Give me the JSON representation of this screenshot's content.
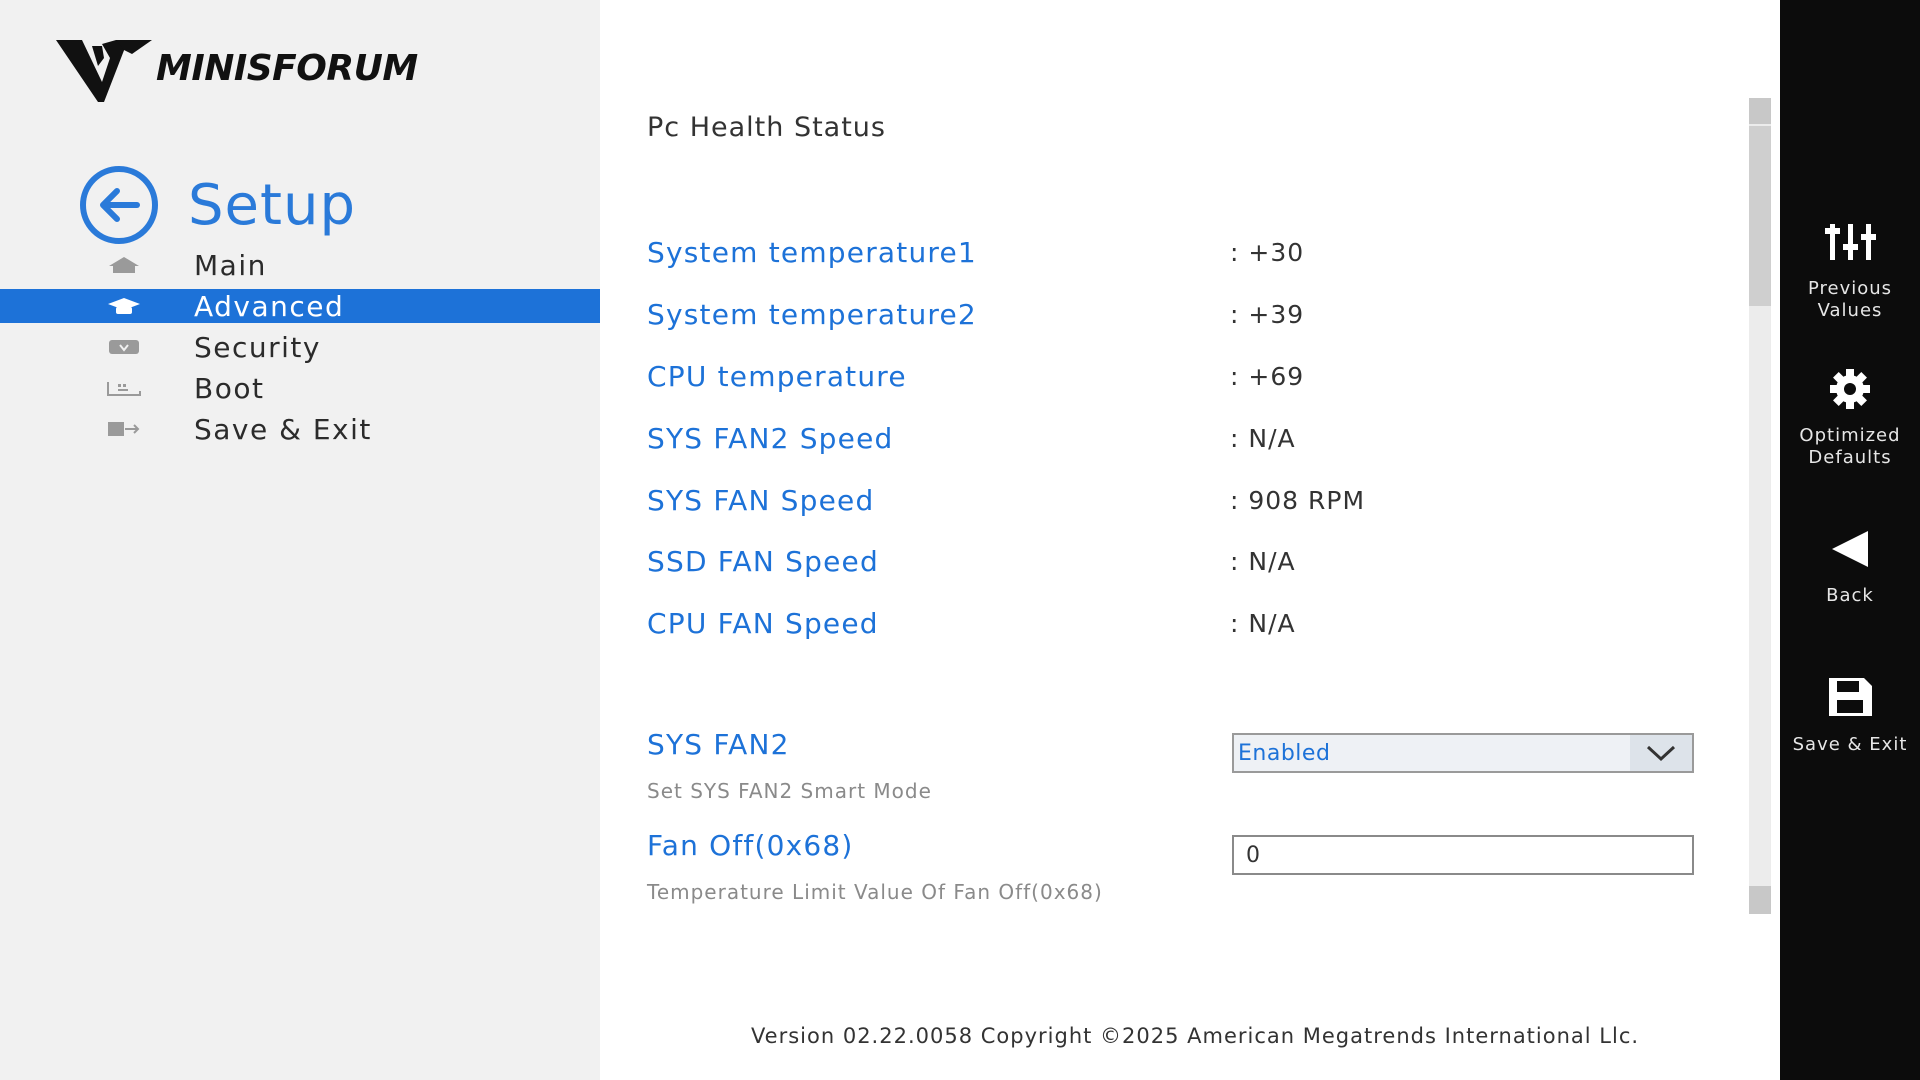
{
  "brand": {
    "logo_text": "MINISFORUM"
  },
  "sidebar": {
    "title": "Setup",
    "items": [
      {
        "label": "Main",
        "icon": "home-icon"
      },
      {
        "label": "Advanced",
        "icon": "graduation-cap-icon",
        "active": true
      },
      {
        "label": "Security",
        "icon": "shield-icon"
      },
      {
        "label": "Boot",
        "icon": "keyboard-icon"
      },
      {
        "label": "Save & Exit",
        "icon": "exit-icon"
      }
    ]
  },
  "main": {
    "title": "Pc Health Status",
    "readings": [
      {
        "label": "System temperature1",
        "value": ": +30"
      },
      {
        "label": "System temperature2",
        "value": ": +39"
      },
      {
        "label": "CPU temperature",
        "value": ": +69"
      },
      {
        "label": "SYS FAN2 Speed",
        "value": ": N/A"
      },
      {
        "label": "SYS FAN Speed",
        "value": ": 908 RPM"
      },
      {
        "label": "SSD FAN Speed",
        "value": ": N/A"
      },
      {
        "label": "CPU FAN Speed",
        "value": ": N/A"
      }
    ],
    "options": {
      "sys_fan2": {
        "label": "SYS FAN2",
        "help": "Set SYS FAN2 Smart Mode",
        "value": "Enabled"
      },
      "fan_off": {
        "label": "Fan Off(0x68)",
        "help": "Temperature Limit Value Of Fan Off(0x68)",
        "value": "0"
      }
    },
    "footer": "Version 02.22.0058 Copyright ©2025 American Megatrends International Llc."
  },
  "actions": {
    "previous_values": "Previous Values",
    "optimized_defaults": "Optimized Defaults",
    "back": "Back",
    "save_exit": "Save & Exit"
  },
  "colors": {
    "accent": "#1d72d8",
    "sidebar_bg": "#f1f1f1",
    "actionbar_bg": "#0c0c0c"
  }
}
